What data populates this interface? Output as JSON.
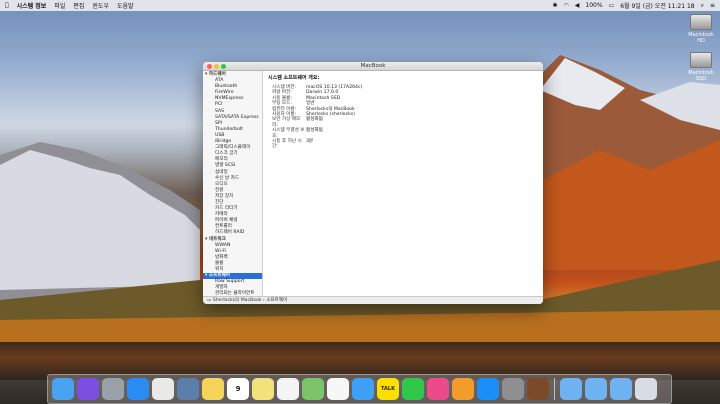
{
  "menubar": {
    "items": [
      "시스템 정보",
      "파일",
      "편집",
      "윈도우",
      "도움말"
    ],
    "clock": "6월 9일 (금) 오전 11:21 18",
    "battery": "100%"
  },
  "desktop": {
    "volumes": [
      "Macintosh HD",
      "Macintosh SSD"
    ]
  },
  "window": {
    "title": "MacBook",
    "sidebar": [
      {
        "label": "하드웨어",
        "head": true
      },
      {
        "label": "ATA"
      },
      {
        "label": "Bluetooth"
      },
      {
        "label": "FireWire"
      },
      {
        "label": "NVMExpress"
      },
      {
        "label": "PCI"
      },
      {
        "label": "SAS"
      },
      {
        "label": "SATA/SATA Express"
      },
      {
        "label": "SPI"
      },
      {
        "label": "Thunderbolt"
      },
      {
        "label": "USB"
      },
      {
        "label": "iBridge"
      },
      {
        "label": "그래픽/디스플레이"
      },
      {
        "label": "디스크 굽기"
      },
      {
        "label": "메모리"
      },
      {
        "label": "병렬 SCSI"
      },
      {
        "label": "섬네일"
      },
      {
        "label": "수신 날 카드"
      },
      {
        "label": "오디오"
      },
      {
        "label": "전원"
      },
      {
        "label": "저장 장치"
      },
      {
        "label": "진단"
      },
      {
        "label": "카드 리더기"
      },
      {
        "label": "카메라"
      },
      {
        "label": "파이버 채널"
      },
      {
        "label": "컨트롤러"
      },
      {
        "label": "하드웨어 RAID"
      },
      {
        "label": "네트워크",
        "head": true
      },
      {
        "label": "WWAN"
      },
      {
        "label": "Wi-Fi"
      },
      {
        "label": "방화벽"
      },
      {
        "label": "볼륨"
      },
      {
        "label": "위치"
      },
      {
        "label": "소프트웨어",
        "head": true,
        "selected": true
      },
      {
        "label": "Raw Support"
      },
      {
        "label": "개발자"
      },
      {
        "label": "관리되는 클라이언트"
      },
      {
        "label": "구성 파일"
      },
      {
        "label": "동기화 서비스"
      }
    ],
    "content_title": "시스템 소프트웨어 개요:",
    "details": [
      {
        "k": "시스템 버전:",
        "v": "macOS 10.13 (17A264c)"
      },
      {
        "k": "커널 버전:",
        "v": "Darwin 17.0.0"
      },
      {
        "k": "시동 볼륨:",
        "v": "Macintosh SSD"
      },
      {
        "k": "부팅 모드:",
        "v": "일반"
      },
      {
        "k": "컴퓨터 이름:",
        "v": "Sherlocks의 MacBook"
      },
      {
        "k": "사용자 이름:",
        "v": "Sherlocks (sherlocks)"
      },
      {
        "k": "보안 가상 메모리:",
        "v": "활성화됨"
      },
      {
        "k": "시스템 무결성 보호:",
        "v": "활성화됨"
      },
      {
        "k": "시동 후 지난 시간:",
        "v": "3분"
      }
    ],
    "statusbar": "Sherlocks의 MacBook › 소프트웨어"
  },
  "dock": {
    "apps": [
      "Finder",
      "Siri",
      "Launchpad",
      "Safari",
      "Chrome",
      "Preview",
      "Notes",
      "Calendar",
      "Stickies",
      "Reminders",
      "Maps",
      "Photos",
      "Messages",
      "KakaoTalk",
      "FaceTime",
      "iTunes",
      "iBooks",
      "App Store",
      "System Preferences",
      "Automator",
      "Applications",
      "Documents",
      "Downloads",
      "Trash"
    ],
    "calendar_day": "9",
    "kakao": "TALK"
  }
}
